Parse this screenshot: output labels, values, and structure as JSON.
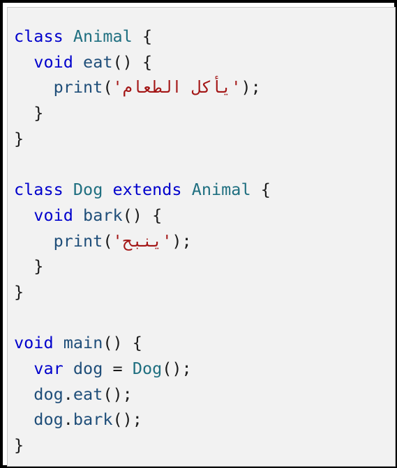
{
  "code": {
    "lines": [
      [
        {
          "t": "class",
          "c": "kw"
        },
        {
          "t": " ",
          "c": "pn"
        },
        {
          "t": "Animal",
          "c": "ty"
        },
        {
          "t": " {",
          "c": "pn"
        }
      ],
      [
        {
          "t": "  ",
          "c": "pn"
        },
        {
          "t": "void",
          "c": "kw"
        },
        {
          "t": " ",
          "c": "pn"
        },
        {
          "t": "eat",
          "c": "fn"
        },
        {
          "t": "() {",
          "c": "pn"
        }
      ],
      [
        {
          "t": "    ",
          "c": "pn"
        },
        {
          "t": "print",
          "c": "fn"
        },
        {
          "t": "(",
          "c": "pn"
        },
        {
          "t": "'يأكل الطعام'",
          "c": "str"
        },
        {
          "t": ");",
          "c": "pn"
        }
      ],
      [
        {
          "t": "  }",
          "c": "pn"
        }
      ],
      [
        {
          "t": "}",
          "c": "pn"
        }
      ],
      [],
      [
        {
          "t": "class",
          "c": "kw"
        },
        {
          "t": " ",
          "c": "pn"
        },
        {
          "t": "Dog",
          "c": "ty"
        },
        {
          "t": " ",
          "c": "pn"
        },
        {
          "t": "extends",
          "c": "kw"
        },
        {
          "t": " ",
          "c": "pn"
        },
        {
          "t": "Animal",
          "c": "ty"
        },
        {
          "t": " {",
          "c": "pn"
        }
      ],
      [
        {
          "t": "  ",
          "c": "pn"
        },
        {
          "t": "void",
          "c": "kw"
        },
        {
          "t": " ",
          "c": "pn"
        },
        {
          "t": "bark",
          "c": "fn"
        },
        {
          "t": "() {",
          "c": "pn"
        }
      ],
      [
        {
          "t": "    ",
          "c": "pn"
        },
        {
          "t": "print",
          "c": "fn"
        },
        {
          "t": "(",
          "c": "pn"
        },
        {
          "t": "'ينبح'",
          "c": "str"
        },
        {
          "t": ");",
          "c": "pn"
        }
      ],
      [
        {
          "t": "  }",
          "c": "pn"
        }
      ],
      [
        {
          "t": "}",
          "c": "pn"
        }
      ],
      [],
      [
        {
          "t": "void",
          "c": "kw"
        },
        {
          "t": " ",
          "c": "pn"
        },
        {
          "t": "main",
          "c": "fn"
        },
        {
          "t": "() {",
          "c": "pn"
        }
      ],
      [
        {
          "t": "  ",
          "c": "pn"
        },
        {
          "t": "var",
          "c": "kw"
        },
        {
          "t": " ",
          "c": "pn"
        },
        {
          "t": "dog",
          "c": "fn"
        },
        {
          "t": " = ",
          "c": "pn"
        },
        {
          "t": "Dog",
          "c": "ty"
        },
        {
          "t": "();",
          "c": "pn"
        }
      ],
      [
        {
          "t": "  ",
          "c": "pn"
        },
        {
          "t": "dog",
          "c": "fn"
        },
        {
          "t": ".",
          "c": "pn"
        },
        {
          "t": "eat",
          "c": "fn"
        },
        {
          "t": "();",
          "c": "pn"
        }
      ],
      [
        {
          "t": "  ",
          "c": "pn"
        },
        {
          "t": "dog",
          "c": "fn"
        },
        {
          "t": ".",
          "c": "pn"
        },
        {
          "t": "bark",
          "c": "fn"
        },
        {
          "t": "();",
          "c": "pn"
        }
      ],
      [
        {
          "t": "}",
          "c": "pn"
        }
      ]
    ]
  },
  "colors": {
    "keyword": "#0000cc",
    "type": "#1f6f80",
    "identifier": "#1f4e79",
    "string": "#a31515",
    "punctuation": "#1a1a1a",
    "background": "#f2f2f2",
    "frame": "#000000"
  }
}
